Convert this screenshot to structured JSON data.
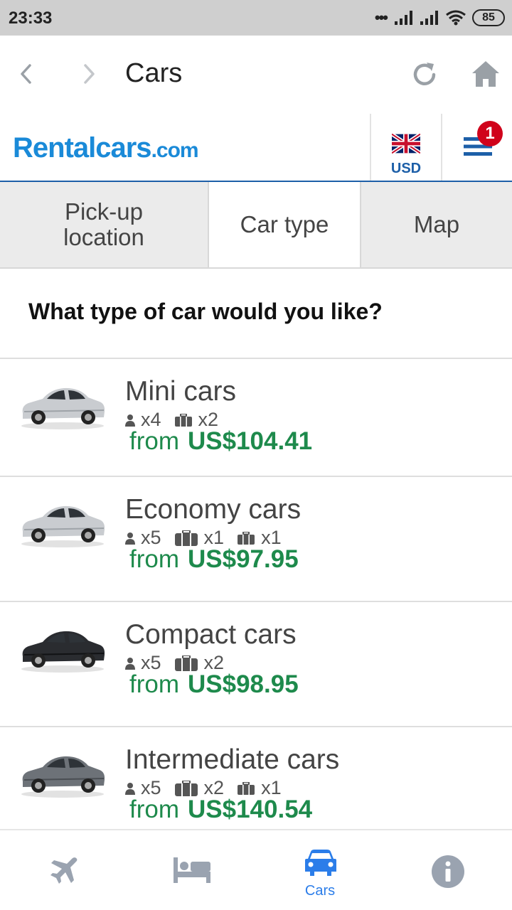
{
  "status": {
    "time": "23:33",
    "battery": "85"
  },
  "browser": {
    "title": "Cars"
  },
  "site": {
    "logo_main": "Rentalcars",
    "logo_suffix": ".com",
    "currency": "USD",
    "menu_badge": "1"
  },
  "tabs": [
    {
      "label": "Pick-up location",
      "active": false
    },
    {
      "label": "Car type",
      "active": true
    },
    {
      "label": "Map",
      "active": false
    }
  ],
  "heading": "What type of car would you like?",
  "cars": [
    {
      "name": "Mini cars",
      "passengers": "x4",
      "large_bags": "",
      "small_bags": "x2",
      "from": "from",
      "price": "US$104.41",
      "color": "silver"
    },
    {
      "name": "Economy cars",
      "passengers": "x5",
      "large_bags": "x1",
      "small_bags": "x1",
      "from": "from",
      "price": "US$97.95",
      "color": "silver"
    },
    {
      "name": "Compact cars",
      "passengers": "x5",
      "large_bags": "x2",
      "small_bags": "",
      "from": "from",
      "price": "US$98.95",
      "color": "black"
    },
    {
      "name": "Intermediate cars",
      "passengers": "x5",
      "large_bags": "x2",
      "small_bags": "x1",
      "from": "from",
      "price": "US$140.54",
      "color": "gray"
    }
  ],
  "bottom_nav": [
    {
      "icon": "plane-icon",
      "label": ""
    },
    {
      "icon": "bed-icon",
      "label": ""
    },
    {
      "icon": "car-icon",
      "label": "Cars",
      "active": true
    },
    {
      "icon": "info-icon",
      "label": ""
    }
  ],
  "colors": {
    "brand_blue": "#1a8ad8",
    "price_green": "#1e8a4c",
    "active_nav": "#2b7de9",
    "badge_red": "#d0021b"
  }
}
